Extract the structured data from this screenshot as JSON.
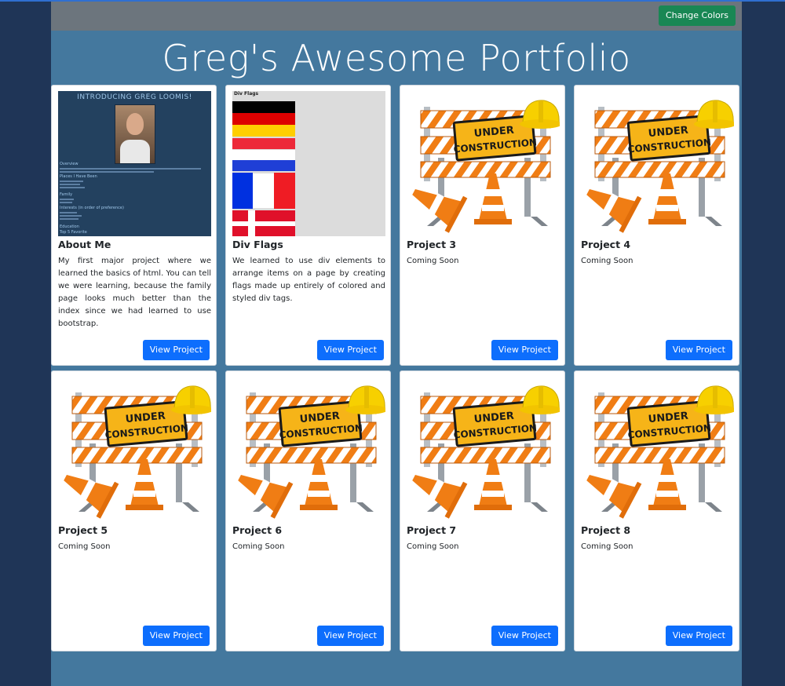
{
  "header": {
    "change_colors_label": "Change Colors"
  },
  "title": "Greg's Awesome Portfolio",
  "about_thumb": {
    "heading": "INTRODUCING GREG LOOMIS!",
    "sections": [
      "Overview",
      "Places I Have Been",
      "Family",
      "Interests (in order of preference)",
      "Education",
      "Top 5 Favorite"
    ]
  },
  "flags_thumb": {
    "heading": "Div Flags"
  },
  "construction_sign": {
    "line1": "UNDER",
    "line2": "CONSTRUCTION"
  },
  "projects": [
    {
      "title": "About Me",
      "text": "My first major project where we learned the basics of html. You can tell we were learning, because the family page looks much better than the index since we had learned to use bootstrap.",
      "button": "View Project"
    },
    {
      "title": "Div Flags",
      "text": "We learned to use div elements to arrange items on a page by creating flags made up entirely of colored and styled div tags.",
      "button": "View Project"
    },
    {
      "title": "Project 3",
      "text": "Coming Soon",
      "button": "View Project"
    },
    {
      "title": "Project 4",
      "text": "Coming Soon",
      "button": "View Project"
    },
    {
      "title": "Project 5",
      "text": "Coming Soon",
      "button": "View Project"
    },
    {
      "title": "Project 6",
      "text": "Coming Soon",
      "button": "View Project"
    },
    {
      "title": "Project 7",
      "text": "Coming Soon",
      "button": "View Project"
    },
    {
      "title": "Project 8",
      "text": "Coming Soon",
      "button": "View Project"
    }
  ],
  "colors": {
    "background": "#1f3557",
    "page": "#44789e",
    "topbar": "#6c757d",
    "change_button": "#198754",
    "view_button": "#0d6efd"
  }
}
